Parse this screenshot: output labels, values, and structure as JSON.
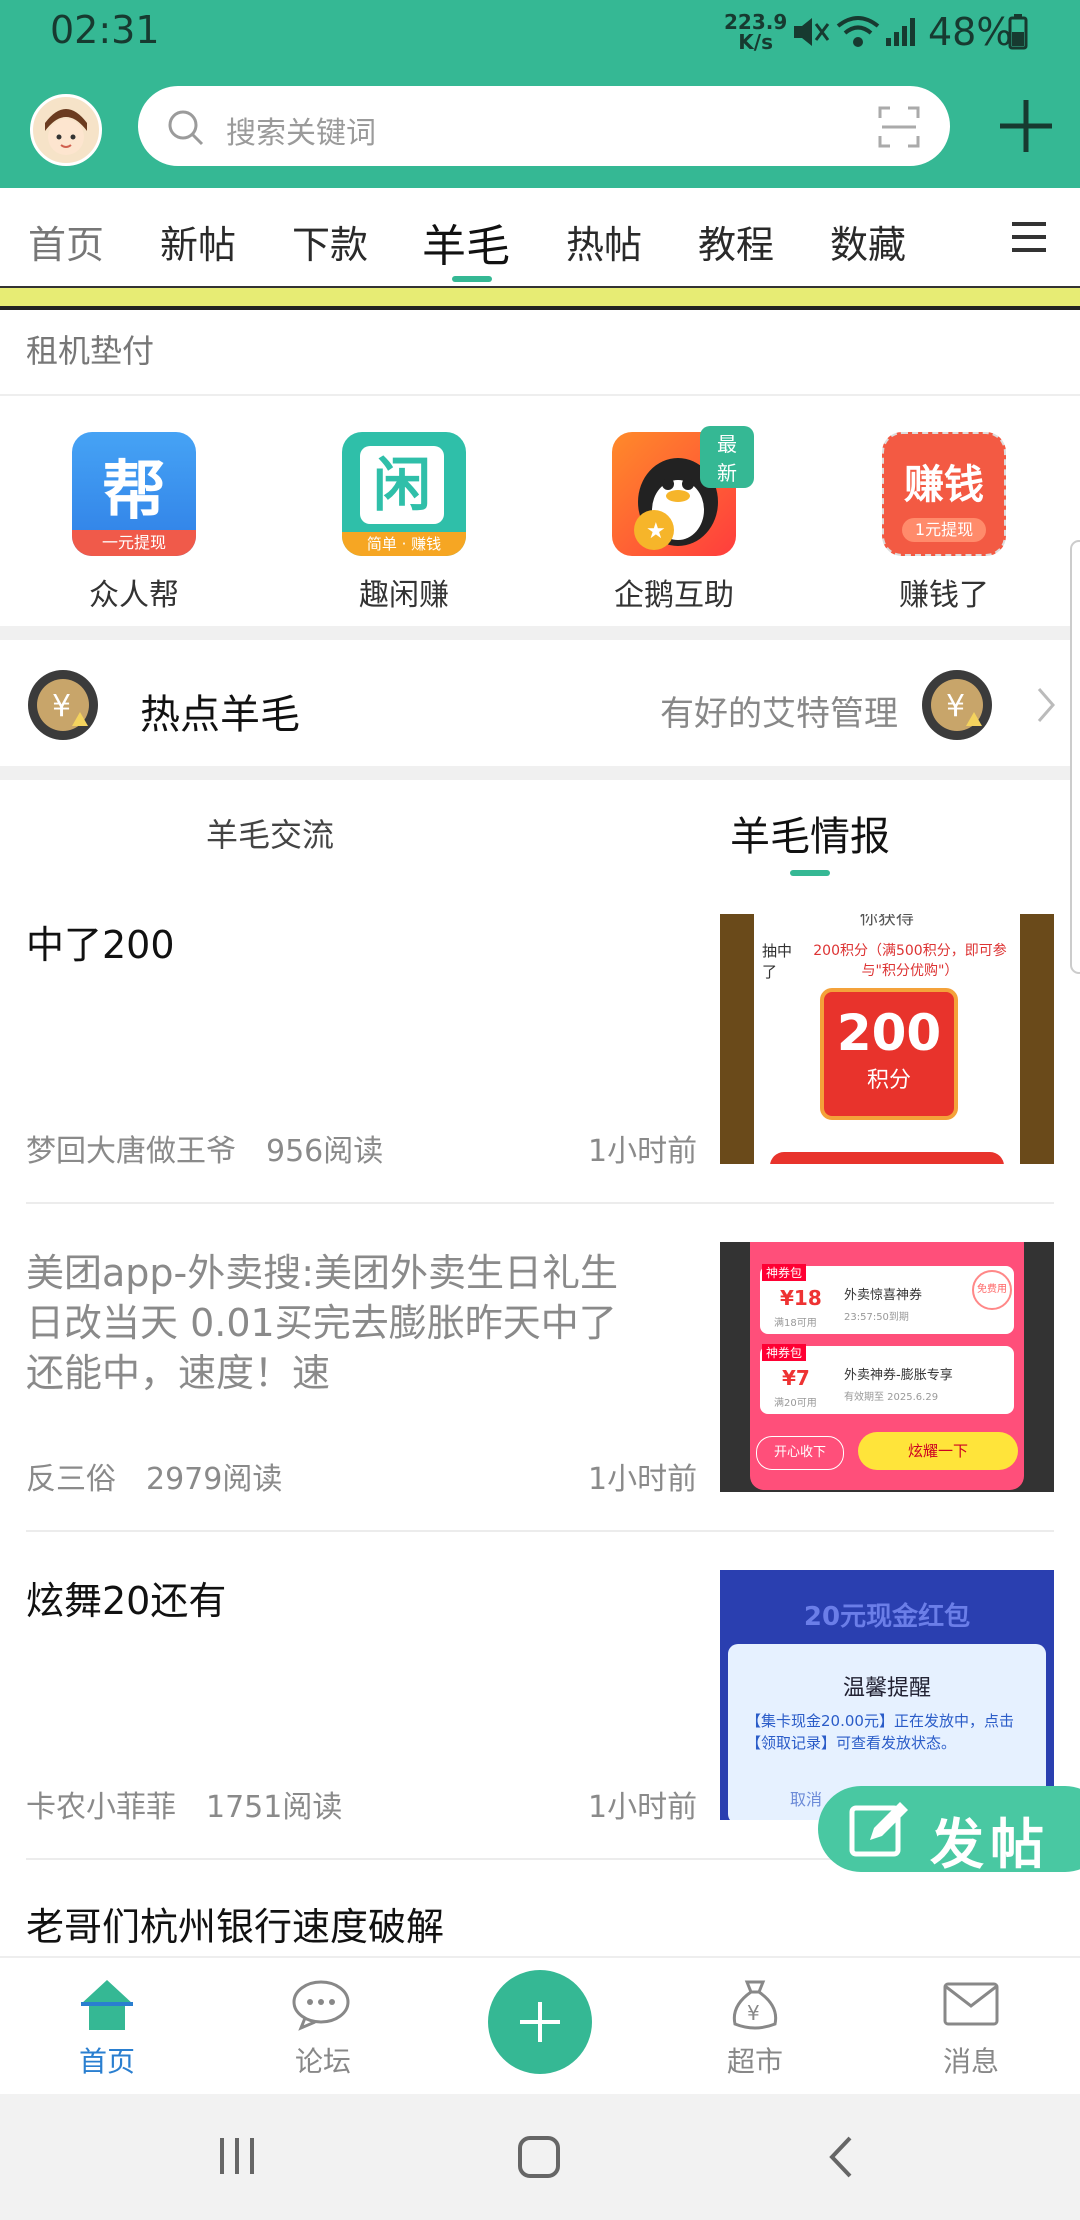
{
  "status": {
    "time": "02:31",
    "net_speed_value": "223.9",
    "net_speed_unit": "K/s",
    "battery": "48%"
  },
  "header": {
    "search_placeholder": "搜索关键词"
  },
  "tabs": [
    {
      "label": "首页"
    },
    {
      "label": "新帖"
    },
    {
      "label": "下款"
    },
    {
      "label": "羊毛"
    },
    {
      "label": "热帖"
    },
    {
      "label": "教程"
    },
    {
      "label": "数藏"
    }
  ],
  "section": {
    "title": "租机垫付"
  },
  "apps": [
    {
      "label": "众人帮",
      "icon_text": "帮",
      "icon_sub": "一元提现"
    },
    {
      "label": "趣闲赚",
      "icon_text": "闲",
      "icon_sub": "简单 · 赚钱"
    },
    {
      "label": "企鹅互助",
      "badge": "最新"
    },
    {
      "label": "赚钱了",
      "icon_text": "赚钱",
      "icon_sub": "1元提现"
    }
  ],
  "hot": {
    "title": "热点羊毛",
    "subtitle": "有好的艾特管理"
  },
  "subtabs": {
    "left": "羊毛交流",
    "right": "羊毛情报"
  },
  "posts": [
    {
      "title": "中了200",
      "author": "梦回大唐做王爷",
      "reads": "956阅读",
      "time": "1小时前",
      "thumb": {
        "line1": "抽中了",
        "line2": "200积分（满500积分，即可参与\"积分优购\"）",
        "big": "200",
        "unit": "积分",
        "top": "你获得"
      }
    },
    {
      "title": "美团app-外卖搜:美团外卖生日礼生日改当天 0.01买完去膨胀昨天中了还能中，速度！速",
      "author": "反三俗",
      "reads": "2979阅读",
      "time": "1小时前",
      "thumb": {
        "tag": "神券包",
        "c1_price": "¥18",
        "c1_cond": "满18可用",
        "c1_name": "外卖惊喜神券",
        "c1_date": "23:57:50到期",
        "c2_price": "¥7",
        "c2_cond": "满20可用",
        "c2_name": "外卖神券-膨胀专享",
        "c2_date": "有效期至 2025.6.29",
        "btn1": "开心收下",
        "btn2": "炫耀一下",
        "stamp": "免费用"
      }
    },
    {
      "title": "炫舞20还有",
      "author": "卡农小菲菲",
      "reads": "1751阅读",
      "time": "1小时前",
      "thumb": {
        "banner": "20元现金红包",
        "head": "温馨提醒",
        "body": "【集卡现金20.00元】正在发放中，点击【领取记录】可查看发放状态。",
        "cancel": "取消"
      }
    },
    {
      "title": "老哥们杭州银行速度破解"
    }
  ],
  "fab": {
    "label": "发帖"
  },
  "bottom_nav": [
    {
      "label": "首页",
      "icon": "home-icon"
    },
    {
      "label": "论坛",
      "icon": "chat-icon"
    },
    {
      "label": "",
      "icon": "plus-icon"
    },
    {
      "label": "超市",
      "icon": "money-bag-icon"
    },
    {
      "label": "消息",
      "icon": "mail-icon"
    }
  ],
  "colors": {
    "brand": "#35b894",
    "active_nav": "#2a7fd0"
  }
}
